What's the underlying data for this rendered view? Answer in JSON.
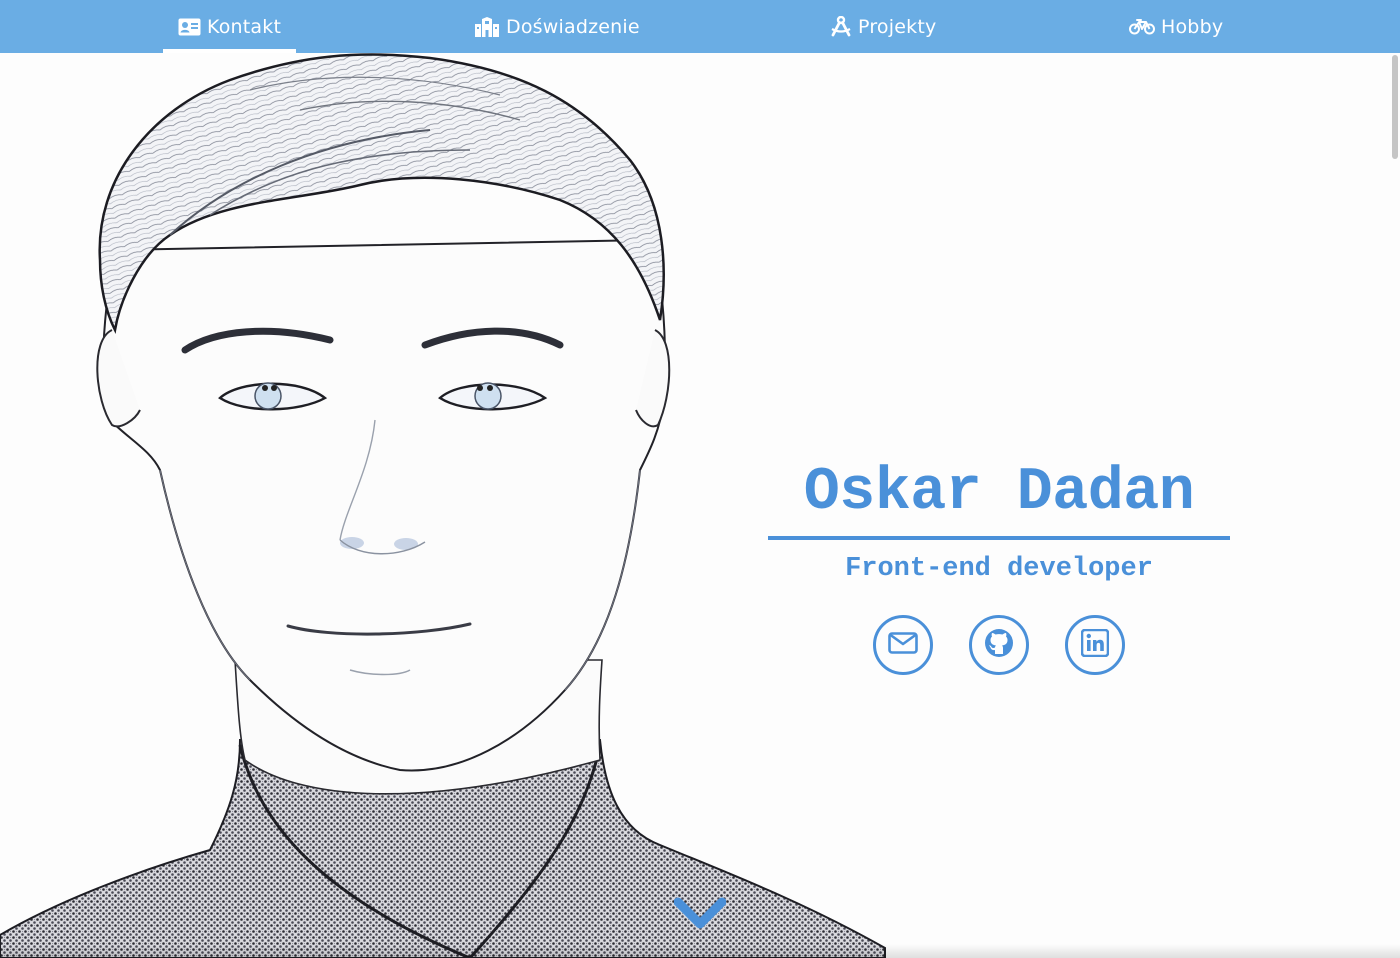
{
  "nav": {
    "items": [
      {
        "id": "kontakt",
        "label": "Kontakt",
        "icon": "contact-card-icon",
        "active": true
      },
      {
        "id": "doswiadczenie",
        "label": "Doświadzenie",
        "icon": "building-icon",
        "active": false
      },
      {
        "id": "projekty",
        "label": "Projekty",
        "icon": "compass-drafting-icon",
        "active": false
      },
      {
        "id": "hobby",
        "label": "Hobby",
        "icon": "bicycle-icon",
        "active": false
      }
    ]
  },
  "hero": {
    "name": "Oskar Dadan",
    "role": "Front-end developer"
  },
  "socials": [
    {
      "icon": "envelope-icon"
    },
    {
      "icon": "github-icon"
    },
    {
      "icon": "linkedin-icon"
    }
  ],
  "colors": {
    "nav_bg": "#6aade4",
    "accent": "#4a90d9",
    "text_light": "#ffffff"
  }
}
